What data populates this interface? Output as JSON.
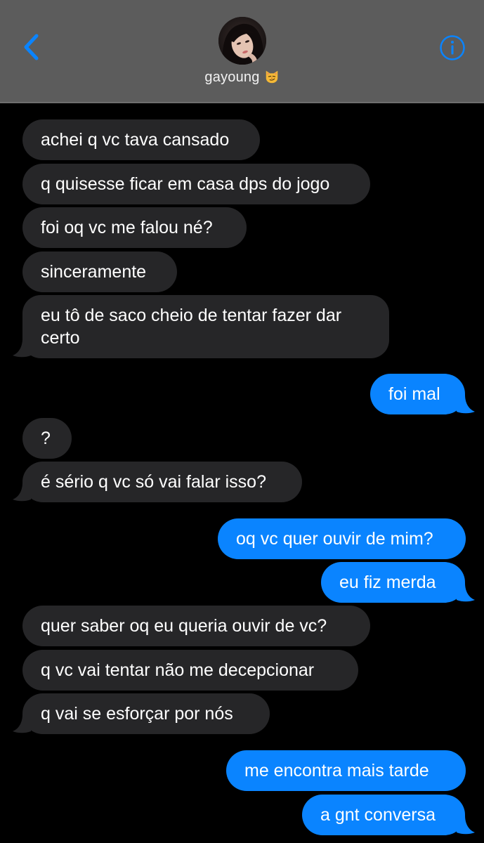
{
  "header": {
    "contact_name": "gayoung",
    "contact_emoji": "😼"
  },
  "colors": {
    "header_bg": "#5c5c5c",
    "received_bubble": "#262628",
    "sent_bubble": "#0a84ff",
    "accent": "#0a84ff"
  },
  "icons": {
    "back": "chevron-left-icon",
    "info": "info-circle-icon",
    "emoji": "smirking-cat-emoji"
  },
  "messages": [
    {
      "direction": "received",
      "text": "achei q vc tava cansado"
    },
    {
      "direction": "received",
      "text": "q quisesse ficar em casa dps do jogo"
    },
    {
      "direction": "received",
      "text": "foi oq vc me falou né?"
    },
    {
      "direction": "received",
      "text": "sinceramente"
    },
    {
      "direction": "received",
      "text": "eu tô de saco cheio de tentar fazer dar certo"
    },
    {
      "direction": "sent",
      "text": "foi mal"
    },
    {
      "direction": "received",
      "text": "?"
    },
    {
      "direction": "received",
      "text": "é sério q vc só vai falar isso?"
    },
    {
      "direction": "sent",
      "text": "oq vc quer ouvir de mim?"
    },
    {
      "direction": "sent",
      "text": "eu fiz merda"
    },
    {
      "direction": "received",
      "text": "quer saber oq eu queria ouvir de vc?"
    },
    {
      "direction": "received",
      "text": "q vc vai tentar não me decepcionar"
    },
    {
      "direction": "received",
      "text": "q vai se esforçar por nós"
    },
    {
      "direction": "sent",
      "text": "me encontra mais tarde"
    },
    {
      "direction": "sent",
      "text": "a gnt conversa"
    }
  ]
}
